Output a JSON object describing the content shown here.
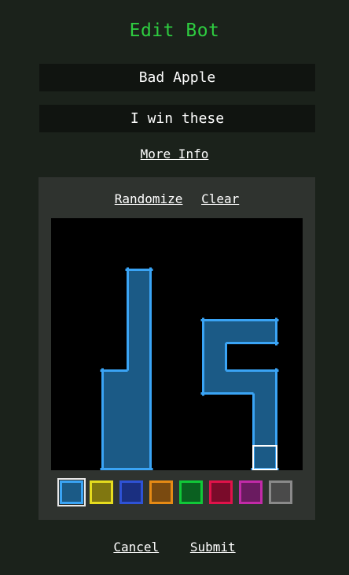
{
  "title": "Edit Bot",
  "name_field": {
    "value": "Bad Apple"
  },
  "motto_field": {
    "value": "I win these"
  },
  "more_info_label": "More Info",
  "editor": {
    "randomize_label": "Randomize",
    "clear_label": "Clear",
    "grid_size": 10,
    "cells": [
      [
        3,
        2
      ],
      [
        3,
        3
      ],
      [
        3,
        4
      ],
      [
        3,
        5
      ],
      [
        3,
        6
      ],
      [
        3,
        7
      ],
      [
        3,
        8
      ],
      [
        3,
        9
      ],
      [
        2,
        6
      ],
      [
        2,
        7
      ],
      [
        2,
        8
      ],
      [
        2,
        9
      ],
      [
        6,
        4
      ],
      [
        7,
        4
      ],
      [
        8,
        4
      ],
      [
        6,
        5
      ],
      [
        6,
        6
      ],
      [
        7,
        6
      ],
      [
        8,
        6
      ],
      [
        8,
        7
      ],
      [
        8,
        8
      ],
      [
        8,
        9
      ]
    ],
    "cursor_cell": [
      8,
      9
    ],
    "cell_color": "#1b5a86",
    "outline_color": "#3aa4f5"
  },
  "palette": [
    {
      "name": "blue",
      "fill": "#1b5a86",
      "border": "#3aa4f5",
      "selected": true
    },
    {
      "name": "yellow",
      "fill": "#807710",
      "border": "#e6dc1e",
      "selected": false
    },
    {
      "name": "navy",
      "fill": "#1a2f80",
      "border": "#2e52d6",
      "selected": false
    },
    {
      "name": "orange",
      "fill": "#7a4a10",
      "border": "#e68a14",
      "selected": false
    },
    {
      "name": "green",
      "fill": "#0a6020",
      "border": "#10c838",
      "selected": false
    },
    {
      "name": "crimson",
      "fill": "#7a0b2a",
      "border": "#e0124a",
      "selected": false
    },
    {
      "name": "purple",
      "fill": "#6a1b60",
      "border": "#c22aa8",
      "selected": false
    },
    {
      "name": "gray",
      "fill": "#4a4a4a",
      "border": "#8a8a8a",
      "selected": false
    }
  ],
  "cancel_label": "Cancel",
  "submit_label": "Submit"
}
